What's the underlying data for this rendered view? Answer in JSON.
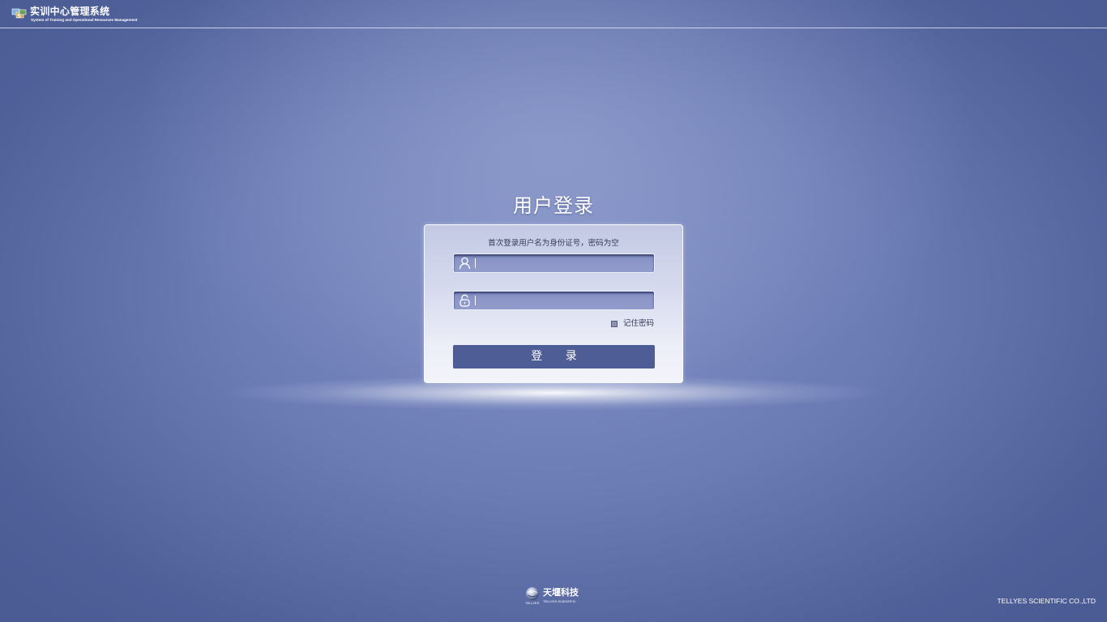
{
  "header": {
    "logo_icon": "training-center-logo-icon",
    "title": "实训中心管理系统",
    "subtitle": "System of Training and Operational Resources Management"
  },
  "login": {
    "heading": "用户登录",
    "hint": "首次登录用户名为身份证号，密码为空",
    "username": {
      "icon": "user-icon",
      "value": "",
      "placeholder": ""
    },
    "password": {
      "icon": "lock-icon",
      "value": "",
      "placeholder": ""
    },
    "remember": {
      "label": "记住密码",
      "checked": false
    },
    "submit_label": "登 录"
  },
  "footer": {
    "company_logo_icon": "globe-icon",
    "company_logo_cn": "天堰科技",
    "company_logo_en_left": "TELLYES",
    "company_logo_en": "TELLYES SCIENTIFIC",
    "copyright": "TELLYES SCIENTIFIC CO.,LTD"
  },
  "colors": {
    "background": "#6b7bb4",
    "button": "#4e5d96",
    "field": "#8b95c7"
  }
}
